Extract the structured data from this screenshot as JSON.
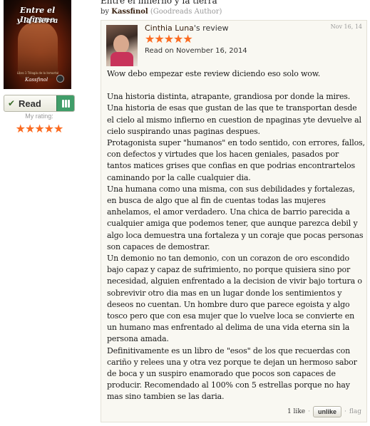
{
  "book": {
    "title": "Entre el infierno y la tierra",
    "by_prefix": "by",
    "author": "Kassfinol",
    "author_role": "(Goodreads Author)",
    "cover_title_line1": "Entre el Infierno",
    "cover_title_line2": "y la Tierra",
    "cover_author": "Kassfinol",
    "cover_series": "Libro 1 Trilogía de lo Inmortal"
  },
  "shelf": {
    "status_label": "Read",
    "check_glyph": "✔",
    "shelf_icon": "bookshelf-icon",
    "my_rating_label": "My rating:",
    "my_rating_stars": 5,
    "my_rating_glyphs": "★★★★★"
  },
  "review": {
    "reviewer_name": "Cinthia Luna",
    "reviewer_suffix": "'s review",
    "date_short": "Nov 16, 14",
    "rating": 5,
    "rating_glyphs": "★★★★★",
    "read_on": "Read on November 16, 2014",
    "paragraphs": [
      "Wow debo empezar este review diciendo eso solo wow.",
      "Una historia distinta, atrapante, grandiosa por donde la mires.",
      "Una historia de esas que gustan de las que te transportan desde el cielo al mismo infierno en cuestion de npaginas yte devuelve al cielo suspirando unas paginas despues.",
      "Protagonista super \"humanos\" en todo sentido, con errores, fallos, con defectos y virtudes que los hacen geniales, pasados por tantos matices grises que confias en que podrias encontrartelos caminando por la calle cualquier dia.",
      "Una humana como una misma, con sus debilidades y fortalezas, en busca de algo que al fin de cuentas todas las mujeres anhelamos, el amor verdadero. Una chica de barrio parecida a cualquier amiga que podemos tener, que aunque parezca debil y algo loca demuestra una fortaleza y un coraje que pocas personas son capaces de demostrar.",
      "Un demonio no tan demonio, con un corazon de oro escondido bajo capaz y capaz de sufrimiento, no porque quisiera sino por necesidad, alguien enfrentado a la decision de vivir bajo tortura o sobrevivir otro dia mas en un lugar donde los sentimientos y deseos no cuentan. Un hombre duro que parece egoista y algo tosco pero que con esa mujer que lo vuelve loca se convierte en un humano mas enfrentado al delima de una vida eterna sin la persona amada.",
      "Definitivamente es un libro de \"esos\" de los que recuerdas con cariño y relees una y otra vez porque te dejan un hermoso sabor de boca y un suspiro enamorado que pocos son capaces de producir. Recomendado al 100% con 5 estrellas porque no hay mas sino tambien se las daria."
    ],
    "likes_text": "1 like",
    "dot_separator": "·",
    "unlike_label": "unlike",
    "flag_label": "flag"
  },
  "colors": {
    "star": "#fb6b21",
    "shelf_green": "#409d69",
    "box_bg": "#f9f8f2",
    "muted": "#999999"
  }
}
